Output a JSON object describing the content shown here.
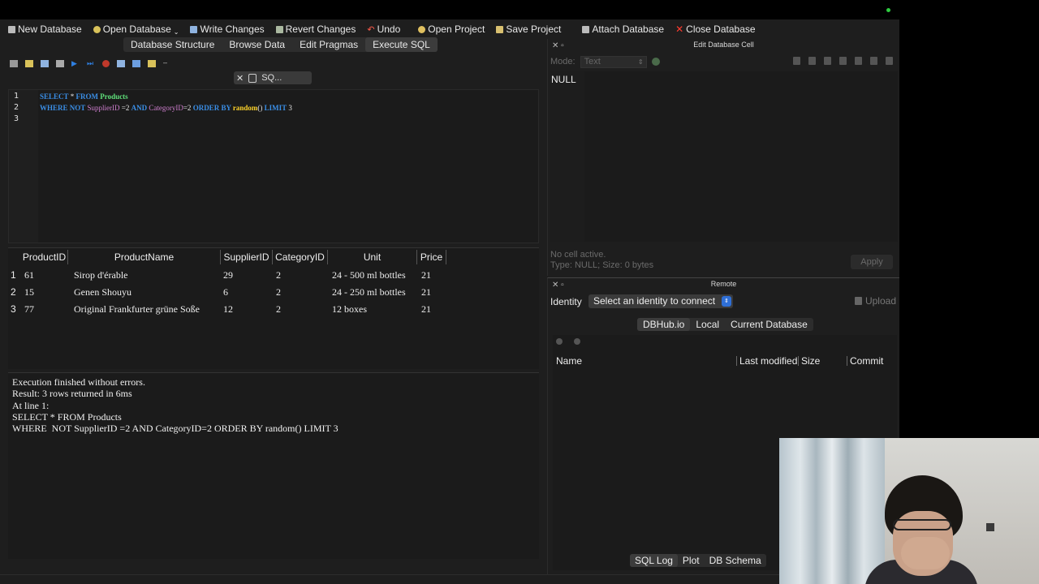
{
  "toolbar": {
    "new_db": "New Database",
    "open_db": "Open Database",
    "write": "Write Changes",
    "revert": "Revert Changes",
    "undo": "Undo",
    "open_project": "Open Project",
    "save_project": "Save Project",
    "attach": "Attach Database",
    "close": "Close Database"
  },
  "main_tabs": [
    "Database Structure",
    "Browse Data",
    "Edit Pragmas",
    "Execute SQL"
  ],
  "sql_tab": {
    "label": "SQ..."
  },
  "editor": {
    "line_numbers": [
      "1",
      "2",
      "3"
    ],
    "line1": {
      "kw1": "SELECT",
      "star": " * ",
      "kw2": "FROM",
      "table": " Products"
    },
    "line2": {
      "kw1": "WHERE",
      "kw2": " NOT",
      "col1": " SupplierID",
      "op1": " =2 ",
      "kw3": "AND",
      "col2": " CategoryID",
      "op2": "=2 ",
      "kw4": "ORDER BY",
      "fn": " random",
      "paren": "() ",
      "kw5": "LIMIT",
      "num": " 3"
    }
  },
  "results": {
    "columns": [
      "ProductID",
      "ProductName",
      "SupplierID",
      "CategoryID",
      "Unit",
      "Price"
    ],
    "rows": [
      {
        "n": "1",
        "cells": [
          "61",
          "Sirop d'érable",
          "29",
          "2",
          "24 - 500 ml bottles",
          "21"
        ]
      },
      {
        "n": "2",
        "cells": [
          "15",
          "Genen Shouyu",
          "6",
          "2",
          "24 - 250 ml bottles",
          "21"
        ]
      },
      {
        "n": "3",
        "cells": [
          "77",
          "Original Frankfurter grüne Soße",
          "12",
          "2",
          "12 boxes",
          "21"
        ]
      }
    ]
  },
  "message": {
    "lines": [
      "Execution finished without errors.",
      "Result: 3 rows returned in 6ms",
      "At line 1:",
      "SELECT * FROM Products",
      "WHERE  NOT SupplierID =2 AND CategoryID=2 ORDER BY random() LIMIT 3"
    ]
  },
  "edit_cell": {
    "title": "Edit Database Cell",
    "mode_label": "Mode:",
    "mode_value": "Text",
    "value": "NULL",
    "status_line1": "No cell active.",
    "status_line2": "Type: NULL; Size: 0 bytes",
    "apply": "Apply"
  },
  "remote": {
    "title": "Remote",
    "identity_label": "Identity",
    "identity_select": "Select an identity to connect",
    "upload": "Upload",
    "tabs": [
      "DBHub.io",
      "Local",
      "Current Database"
    ],
    "columns": [
      "Name",
      "Last modified",
      "Size",
      "Commit"
    ]
  },
  "bottom_tabs": [
    "SQL Log",
    "Plot",
    "DB Schema"
  ],
  "colors": {
    "background": "#1e1e1e",
    "keyword": "#3a8ee6",
    "identifier": "#d07fd0",
    "table": "#5fe07a",
    "function": "#ffd42a",
    "close_red": "#ff3b30"
  }
}
